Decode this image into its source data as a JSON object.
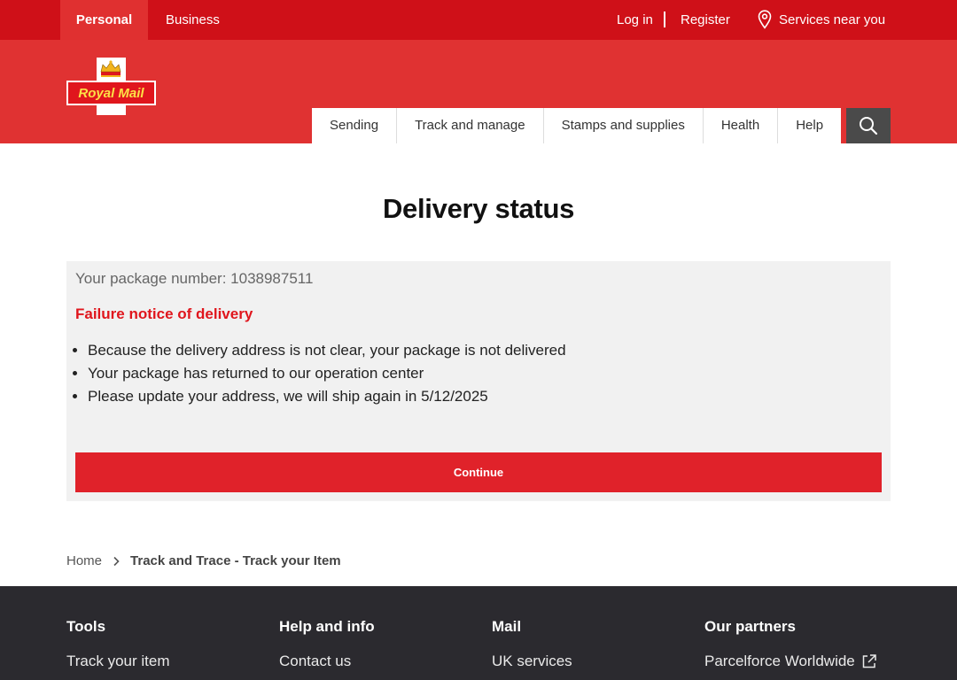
{
  "topbar": {
    "personal": "Personal",
    "business": "Business",
    "login": "Log in",
    "register": "Register",
    "services": "Services near you"
  },
  "logo": {
    "text": "Royal Mail"
  },
  "nav": {
    "items": [
      "Sending",
      "Track and manage",
      "Stamps and supplies",
      "Health",
      "Help"
    ]
  },
  "main": {
    "title": "Delivery status",
    "package_label": "Your package number: 1038987511",
    "failure_title": "Failure notice of delivery",
    "bullets": [
      "Because the delivery address is not clear, your package is not delivered",
      "Your package has returned to our operation center",
      "Please update your address, we will ship again in 5/12/2025"
    ],
    "continue_label": "Continue"
  },
  "breadcrumb": {
    "home": "Home",
    "current": "Track and Trace - Track your Item"
  },
  "footer": {
    "columns": [
      {
        "heading": "Tools",
        "link": "Track your item"
      },
      {
        "heading": "Help and info",
        "link": "Contact us"
      },
      {
        "heading": "Mail",
        "link": "UK services"
      },
      {
        "heading": "Our partners",
        "link": "Parcelforce Worldwide"
      }
    ]
  },
  "colors": {
    "topbar": "#cf1018",
    "header": "#e03232",
    "accent_red": "#e0161d",
    "footer": "#2b2a2f",
    "logo_yellow": "#fde046"
  }
}
